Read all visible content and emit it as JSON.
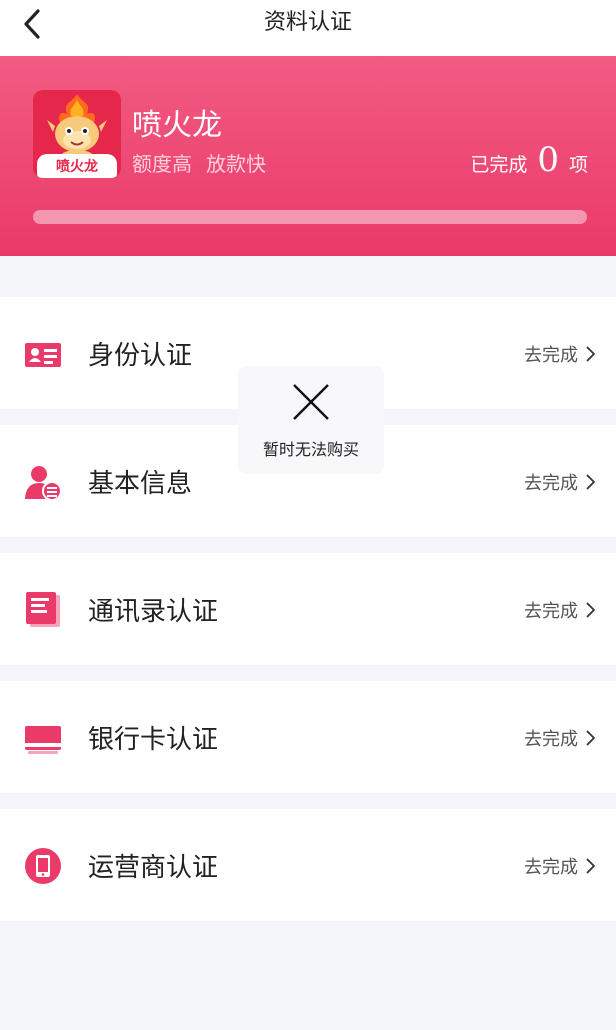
{
  "nav": {
    "title": "资料认证"
  },
  "app": {
    "name": "喷火龙",
    "logo_caption": "喷火龙",
    "tags": [
      "额度高",
      "放款快"
    ]
  },
  "progress": {
    "prefix": "已完成",
    "completed": "0",
    "suffix": "项",
    "fraction": 0
  },
  "items": [
    {
      "label": "身份认证",
      "action": "去完成",
      "icon": "id-card-icon"
    },
    {
      "label": "基本信息",
      "action": "去完成",
      "icon": "user-info-icon"
    },
    {
      "label": "通讯录认证",
      "action": "去完成",
      "icon": "contacts-book-icon"
    },
    {
      "label": "银行卡认证",
      "action": "去完成",
      "icon": "bank-card-icon"
    },
    {
      "label": "运营商认证",
      "action": "去完成",
      "icon": "phone-icon"
    }
  ],
  "toast": {
    "text": "暂时无法购买",
    "icon": "close-icon"
  },
  "colors": {
    "accent": "#ea3a69",
    "banner_top": "#f25b83",
    "background": "#f5f6fa"
  }
}
